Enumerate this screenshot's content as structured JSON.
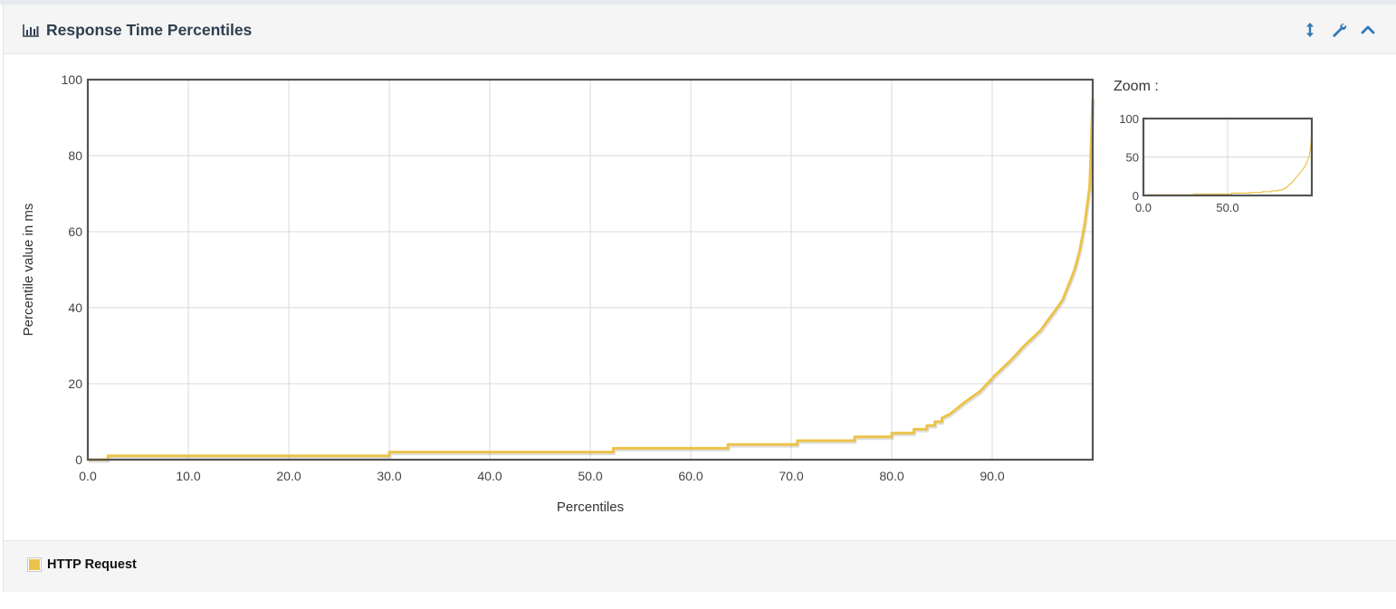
{
  "panel": {
    "title": "Response Time Percentiles",
    "icons": [
      "bar-chart-icon",
      "resize-vertical-icon",
      "wrench-icon",
      "chevron-up-icon"
    ]
  },
  "zoom": {
    "label": "Zoom :"
  },
  "legend": {
    "items": [
      {
        "label": "HTTP Request",
        "color": "#ecc34a"
      }
    ]
  },
  "colors": {
    "series": "#ecc34a",
    "frame": "#545454",
    "grid": "#d8d8d8",
    "title": "#2f4050",
    "icon": "#337ab7"
  },
  "chart_data": {
    "type": "line",
    "xlabel": "Percentiles",
    "ylabel": "Percentile value in ms",
    "xlim": [
      0,
      100
    ],
    "ylim": [
      0,
      100
    ],
    "x_ticks": [
      0,
      10,
      20,
      30,
      40,
      50,
      60,
      70,
      80,
      90
    ],
    "y_ticks": [
      0,
      20,
      40,
      60,
      80,
      100
    ],
    "grid": true,
    "legend_position": "bottom",
    "series": [
      {
        "name": "HTTP Request",
        "x": [
          0.0,
          2.0,
          2.0,
          30.0,
          30.0,
          52.3,
          52.3,
          63.7,
          63.7,
          70.6,
          70.6,
          76.3,
          76.3,
          80.0,
          80.0,
          82.2,
          82.2,
          83.5,
          83.5,
          84.3,
          84.3,
          85.0,
          85.0,
          85.8,
          86.5,
          87.2,
          88.0,
          88.8,
          89.5,
          90.2,
          91.0,
          91.8,
          92.5,
          93.2,
          94.0,
          94.8,
          95.5,
          96.2,
          97.0,
          97.6,
          98.2,
          98.7,
          99.2,
          99.5,
          99.7,
          99.85,
          100.0
        ],
        "y": [
          0,
          0,
          1,
          1,
          2,
          2,
          3,
          3,
          4,
          4,
          5,
          5,
          6,
          6,
          7,
          7,
          8,
          8,
          9,
          9,
          10,
          10,
          11,
          12,
          13.5,
          15,
          16.5,
          18,
          20,
          22,
          24,
          26,
          28,
          30,
          32,
          34,
          36.5,
          39,
          42,
          46,
          50,
          55,
          62,
          68,
          72,
          83,
          95
        ]
      }
    ],
    "zoom_chart": {
      "x_ticks": [
        0,
        50
      ],
      "y_ticks": [
        0,
        50,
        100
      ],
      "xlim": [
        0,
        100
      ],
      "ylim": [
        0,
        100
      ]
    }
  }
}
